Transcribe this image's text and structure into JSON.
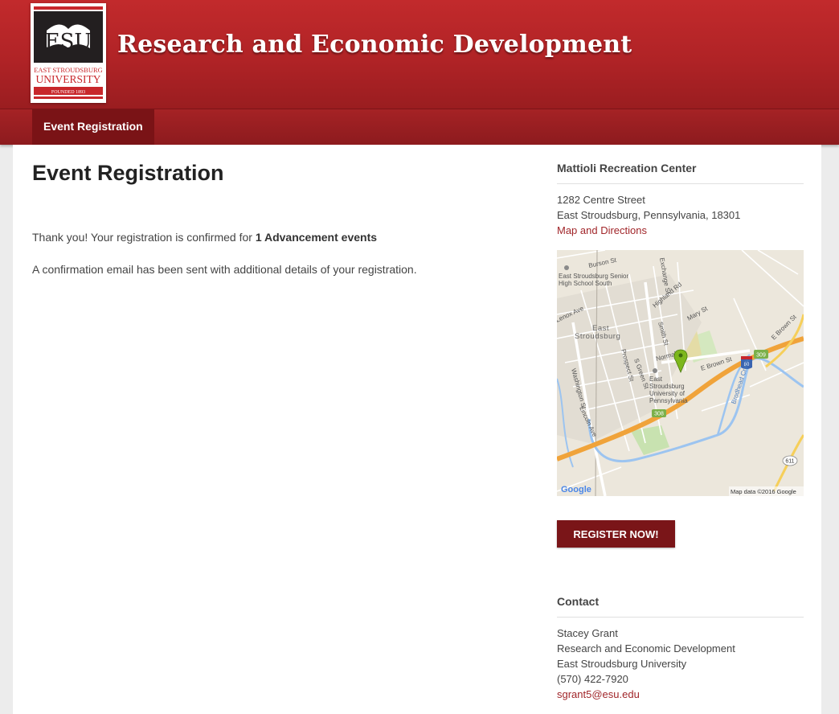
{
  "header": {
    "site_title": "Research and Economic Development",
    "logo": {
      "initials": "ESU",
      "line1": "EAST STROUDSBURG",
      "line2": "UNIVERSITY",
      "founded": "FOUNDED 1893"
    }
  },
  "nav": {
    "items": [
      {
        "label": "Event Registration"
      }
    ]
  },
  "main": {
    "title": "Event Registration",
    "confirm_prefix": "Thank you! Your registration is confirmed for ",
    "confirm_bold": "1 Advancement events",
    "email_note": "A confirmation email has been sent with additional details of your registration."
  },
  "sidebar": {
    "location": {
      "heading": "Mattioli Recreation Center",
      "street": "1282 Centre Street",
      "city": "East Stroudsburg, Pennsylvania, 18301",
      "directions_link": "Map and Directions"
    },
    "map": {
      "labels": {
        "burson": "Burson St",
        "exchange": "Exchange St",
        "school1": "East Stroudsburg Senior",
        "school2": "High School South",
        "highland": "Highland Rd",
        "lenox": "Lenox Ave",
        "mary": "Mary St",
        "smith": "Smith St",
        "ebrown_top": "E Brown St",
        "town1": "East",
        "town2": "Stroudsburg",
        "sgreen": "S Green St",
        "normal": "Normal St",
        "prospect": "Prospect St",
        "washington": "Washington St",
        "ebrown": "E Brown St",
        "univ1": "East",
        "univ2": "Stroudsburg",
        "univ3": "University of",
        "univ4": "Pennsylvania",
        "lincoln": "Lincoln Ave",
        "brodhead": "Brodhead Creek",
        "r309": "309",
        "r80": "80",
        "r308": "308",
        "r611": "611",
        "google": "Google",
        "attribution": "Map data ©2016 Google"
      }
    },
    "register_button": "REGISTER NOW!",
    "contact": {
      "heading": "Contact",
      "name": "Stacey Grant",
      "dept": "Research and Economic Development",
      "org": "East Stroudsburg University",
      "phone": "(570) 422-7920",
      "email": "sgrant5@esu.edu"
    }
  },
  "colors": {
    "brand_red": "#b02326",
    "nav_active": "#7a1316",
    "button": "#7a1518",
    "link": "#a1262a",
    "highway": "#f2a43a",
    "water": "#9cc4f0",
    "campus": "#e4dca6",
    "park": "#c8e2b0",
    "marker": "#7db71c"
  }
}
